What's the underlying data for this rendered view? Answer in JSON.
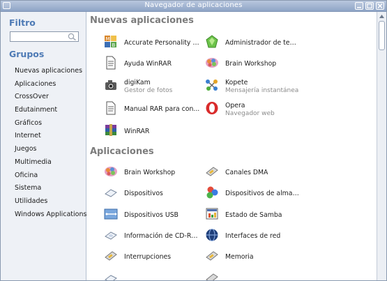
{
  "window": {
    "title": "Navegador de aplicaciones"
  },
  "sidebar": {
    "filter_heading": "Filtro",
    "search": {
      "value": "",
      "placeholder": ""
    },
    "groups_heading": "Grupos",
    "categories": [
      "Nuevas aplicaciones",
      "Aplicaciones",
      "CrossOver",
      "Edutainment",
      "Gráficos",
      "Internet",
      "Juegos",
      "Multimedia",
      "Oficina",
      "Sistema",
      "Utilidades",
      "Windows Applications"
    ]
  },
  "sections": [
    {
      "title": "Nuevas aplicaciones",
      "items": [
        {
          "name": "Accurate Personality T...",
          "sub": "",
          "icon": "personality-test-icon"
        },
        {
          "name": "Administrador de tema...",
          "sub": "",
          "icon": "theme-manager-icon"
        },
        {
          "name": "Ayuda WinRAR",
          "sub": "",
          "icon": "document-icon"
        },
        {
          "name": "Brain Workshop",
          "sub": "",
          "icon": "brain-icon"
        },
        {
          "name": "digiKam",
          "sub": "Gestor de fotos",
          "icon": "camera-icon"
        },
        {
          "name": "Kopete",
          "sub": "Mensajería instantánea",
          "icon": "kopete-icon"
        },
        {
          "name": "Manual RAR para con...",
          "sub": "",
          "icon": "document-icon"
        },
        {
          "name": "Opera",
          "sub": "Navegador web",
          "icon": "opera-icon"
        },
        {
          "name": "WinRAR",
          "sub": "",
          "icon": "winrar-icon"
        }
      ]
    },
    {
      "title": "Aplicaciones",
      "items": [
        {
          "name": "Brain Workshop",
          "sub": "",
          "icon": "brain-icon"
        },
        {
          "name": "Canales DMA",
          "sub": "",
          "icon": "dma-icon"
        },
        {
          "name": "Dispositivos",
          "sub": "",
          "icon": "drive-icon"
        },
        {
          "name": "Dispositivos de almac...",
          "sub": "",
          "icon": "storage-icon"
        },
        {
          "name": "Dispositivos USB",
          "sub": "",
          "icon": "usb-icon"
        },
        {
          "name": "Estado de Samba",
          "sub": "",
          "icon": "samba-icon"
        },
        {
          "name": "Información de CD-ROM",
          "sub": "",
          "icon": "cdrom-icon"
        },
        {
          "name": "Interfaces de red",
          "sub": "",
          "icon": "network-icon"
        },
        {
          "name": "Interrupciones",
          "sub": "",
          "icon": "interrupts-icon"
        },
        {
          "name": "Memoria",
          "sub": "",
          "icon": "memory-icon"
        }
      ]
    }
  ],
  "colors": {
    "accent": "#4d7ab5",
    "section_title": "#7c7c7c",
    "titlebar": "#9fb1cf"
  }
}
